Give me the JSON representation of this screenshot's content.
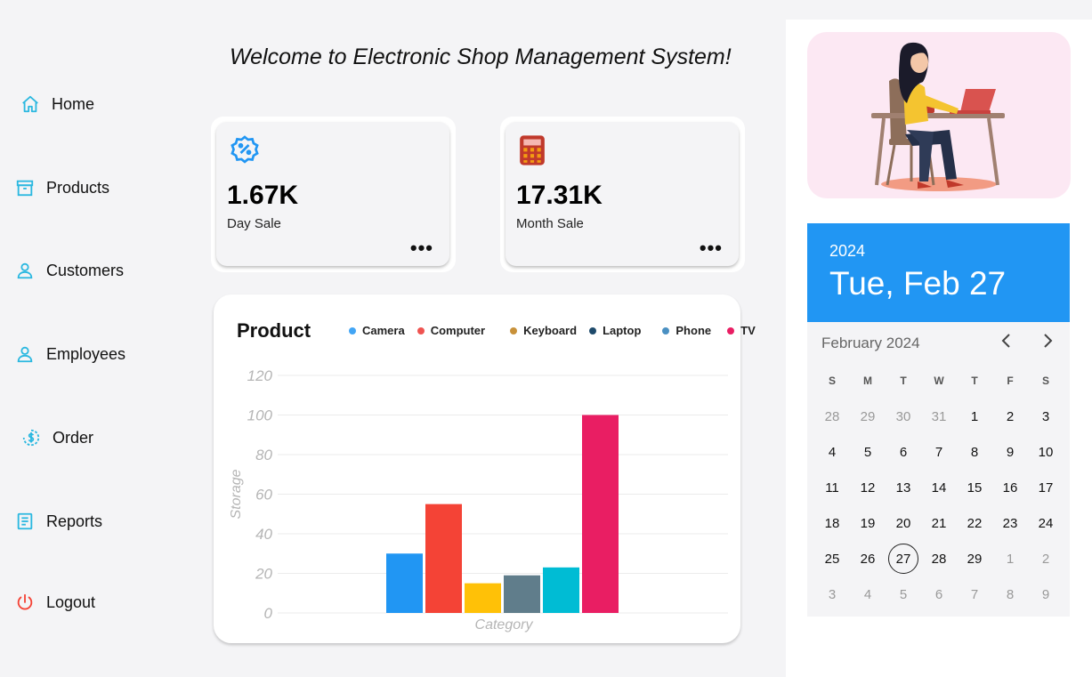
{
  "title": "Welcome to Electronic Shop Management System!",
  "sidebar": {
    "items": [
      {
        "label": "Home",
        "icon": "home-icon",
        "color": "#2bb8e0"
      },
      {
        "label": "Products",
        "icon": "archive-box-icon",
        "color": "#2bb8e0"
      },
      {
        "label": "Customers",
        "icon": "user-icon",
        "color": "#2bb8e0"
      },
      {
        "label": "Employees",
        "icon": "user-icon",
        "color": "#2bb8e0"
      },
      {
        "label": "Order",
        "icon": "dollar-refresh-icon",
        "color": "#2bb8e0"
      },
      {
        "label": "Reports",
        "icon": "report-icon",
        "color": "#2bb8e0"
      },
      {
        "label": "Logout",
        "icon": "power-icon",
        "color": "#f44336"
      }
    ]
  },
  "stats": [
    {
      "value": "1.67K",
      "label": "Day Sale",
      "icon": "discount-badge-icon",
      "more": "•••"
    },
    {
      "value": "17.31K",
      "label": "Month Sale",
      "icon": "calculator-icon",
      "more": "•••"
    }
  ],
  "chart_data": {
    "type": "bar",
    "title": "Product",
    "xlabel": "Category",
    "ylabel": "Storage",
    "ylim": [
      0,
      120
    ],
    "yticks": [
      0,
      20,
      40,
      60,
      80,
      100,
      120
    ],
    "grid": true,
    "legend_position": "top",
    "categories": [
      "Camera",
      "Computer",
      "Keyboard",
      "Laptop",
      "Phone",
      "TV"
    ],
    "values": [
      30,
      55,
      15,
      19,
      23,
      100
    ],
    "bar_colors": [
      "#2196f3",
      "#f44336",
      "#ffc107",
      "#607d8b",
      "#00bcd4",
      "#e91e63"
    ],
    "legend_colors": [
      "#42a5f5",
      "#ef5350",
      "#c8913a",
      "#1e4a6b",
      "#4a90c2",
      "#e91e63"
    ]
  },
  "calendar": {
    "year": "2024",
    "date_label": "Tue, Feb 27",
    "month_label": "February 2024",
    "prev": "‹",
    "next": "›",
    "weekdays": [
      "S",
      "M",
      "T",
      "W",
      "T",
      "F",
      "S"
    ],
    "selected_day": "27",
    "weeks": [
      [
        {
          "d": "28",
          "m": true
        },
        {
          "d": "29",
          "m": true
        },
        {
          "d": "30",
          "m": true
        },
        {
          "d": "31",
          "m": true
        },
        {
          "d": "1"
        },
        {
          "d": "2"
        },
        {
          "d": "3"
        }
      ],
      [
        {
          "d": "4"
        },
        {
          "d": "5"
        },
        {
          "d": "6"
        },
        {
          "d": "7"
        },
        {
          "d": "8"
        },
        {
          "d": "9"
        },
        {
          "d": "10"
        }
      ],
      [
        {
          "d": "11"
        },
        {
          "d": "12"
        },
        {
          "d": "13"
        },
        {
          "d": "14"
        },
        {
          "d": "15"
        },
        {
          "d": "16"
        },
        {
          "d": "17"
        }
      ],
      [
        {
          "d": "18"
        },
        {
          "d": "19"
        },
        {
          "d": "20"
        },
        {
          "d": "21"
        },
        {
          "d": "22"
        },
        {
          "d": "23"
        },
        {
          "d": "24"
        }
      ],
      [
        {
          "d": "25"
        },
        {
          "d": "26"
        },
        {
          "d": "27",
          "today": true
        },
        {
          "d": "28"
        },
        {
          "d": "29"
        },
        {
          "d": "1",
          "m": true
        },
        {
          "d": "2",
          "m": true
        }
      ],
      [
        {
          "d": "3",
          "m": true
        },
        {
          "d": "4",
          "m": true
        },
        {
          "d": "5",
          "m": true
        },
        {
          "d": "6",
          "m": true
        },
        {
          "d": "7",
          "m": true
        },
        {
          "d": "8",
          "m": true
        },
        {
          "d": "9",
          "m": true
        }
      ]
    ]
  },
  "accent_color": "#2196f3"
}
